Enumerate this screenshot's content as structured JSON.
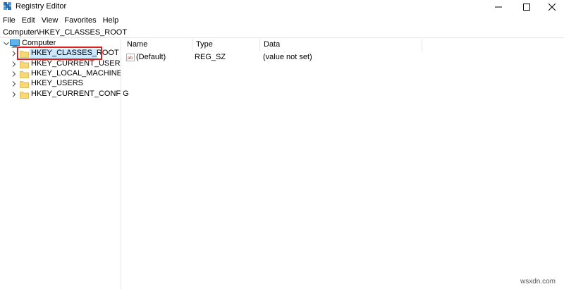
{
  "window": {
    "title": "Registry Editor",
    "icon": "registry-editor-icon"
  },
  "menu": {
    "items": [
      "File",
      "Edit",
      "View",
      "Favorites",
      "Help"
    ]
  },
  "address": {
    "path": "Computer\\HKEY_CLASSES_ROOT"
  },
  "tree": {
    "root": "Computer",
    "items": [
      {
        "label": "HKEY_CLASSES_ROOT",
        "selected": true
      },
      {
        "label": "HKEY_CURRENT_USER"
      },
      {
        "label": "HKEY_LOCAL_MACHINE"
      },
      {
        "label": "HKEY_USERS"
      },
      {
        "label": "HKEY_CURRENT_CONFIG"
      }
    ]
  },
  "list": {
    "columns": [
      "Name",
      "Type",
      "Data"
    ],
    "rows": [
      {
        "name": "(Default)",
        "type": "REG_SZ",
        "data": "(value not set)",
        "icon": "string-value-icon"
      }
    ]
  },
  "watermark": "wsxdn.com",
  "colors": {
    "selection": "#cce8ff",
    "annotation": "#e02020",
    "folder": "#f8d775"
  }
}
